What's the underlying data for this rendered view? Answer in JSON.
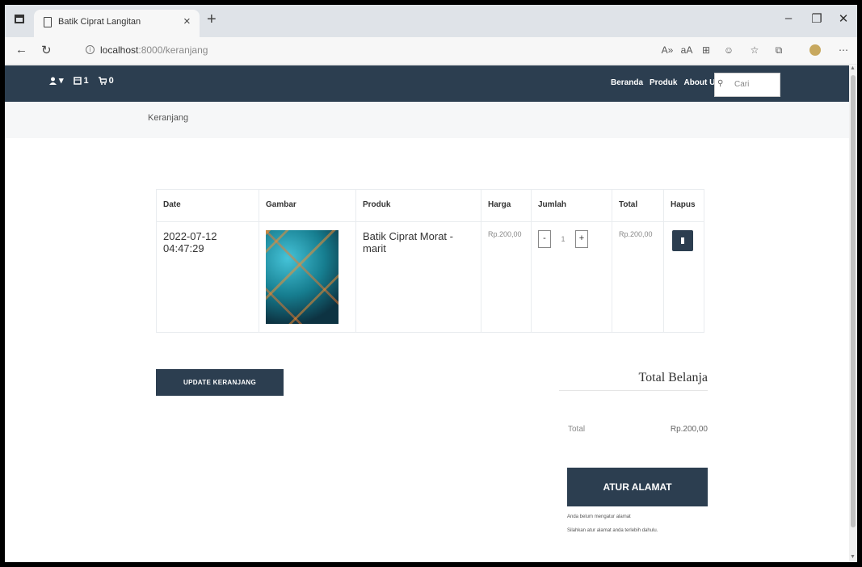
{
  "browser": {
    "tab_title": "Batik Ciprat Langitan",
    "tab_close": "×",
    "new_tab": "+",
    "url_host": "localhost",
    "url_path": ":8000/keranjang",
    "window_controls": {
      "minimize": "–",
      "restore": "❐",
      "close": "✕"
    },
    "nav": {
      "back": "←",
      "refresh": "↻"
    },
    "toolbar": [
      "A»",
      "aA",
      "⊞",
      "☺",
      "☆",
      "⧉",
      "⋯"
    ]
  },
  "site": {
    "top_left": {
      "user": "▾",
      "wishlist_count": "1",
      "cart_count": "0"
    },
    "menu": [
      "Beranda",
      "Produk",
      "About Us"
    ],
    "search_placeholder": "Cari"
  },
  "breadcrumb": "Keranjang",
  "cart": {
    "headers": [
      "Date",
      "Gambar",
      "Produk",
      "Harga",
      "Jumlah",
      "Total",
      "Hapus"
    ],
    "rows": [
      {
        "date": "2022-07-12 04:47:29",
        "product": "Batik Ciprat Morat - marit",
        "price": "Rp.200,00",
        "quantity": "1",
        "total": "Rp.200,00"
      }
    ],
    "minus": "-",
    "plus": "+"
  },
  "update_button": "UPDATE KERANJANG",
  "totals": {
    "title": "Total Belanja",
    "label": "Total",
    "value": "Rp.200,00"
  },
  "address_button": "ATUR ALAMAT",
  "notes": [
    "Anda belum mengatur alamat",
    "Silahkan atur alamat anda terlebih dahulu."
  ]
}
